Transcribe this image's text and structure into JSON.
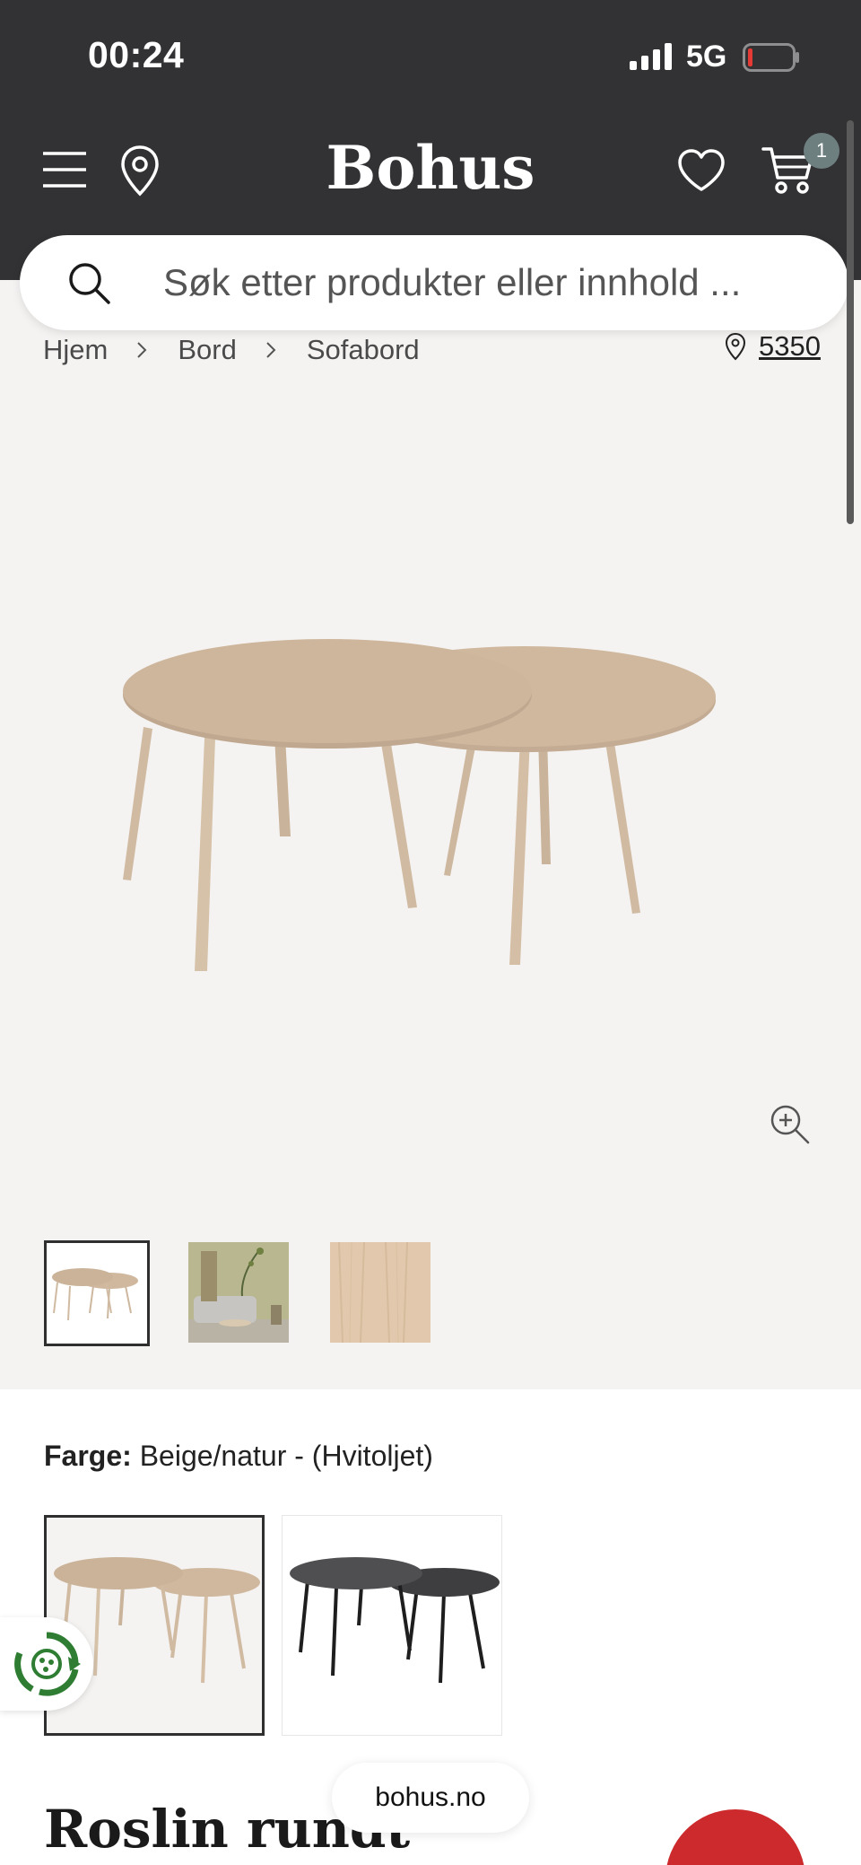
{
  "status_bar": {
    "time": "00:24",
    "network": "5G"
  },
  "header": {
    "logo": "Bohus",
    "cart_count": "1"
  },
  "search": {
    "placeholder": "Søk etter produkter eller innhold ..."
  },
  "breadcrumb": {
    "items": [
      "Hjem",
      "Bord",
      "Sofabord"
    ],
    "store_number": "5350"
  },
  "product": {
    "color_label": "Farge:",
    "color_value": "Beige/natur - (Hvitoljet)",
    "title": "Roslin rundt"
  },
  "browser": {
    "url": "bohus.no"
  },
  "colors": {
    "header_bg": "#323134",
    "page_bg": "#f5f3f2",
    "wood": "#cbb49d",
    "sale_red": "#cc2a2c",
    "badge_teal": "#6e7f80"
  },
  "icons": [
    "signal-icon",
    "battery-icon",
    "menu-icon",
    "location-pin-icon",
    "heart-icon",
    "cart-icon",
    "search-icon",
    "chevron-right-icon",
    "zoom-in-icon",
    "recycle-icon"
  ]
}
